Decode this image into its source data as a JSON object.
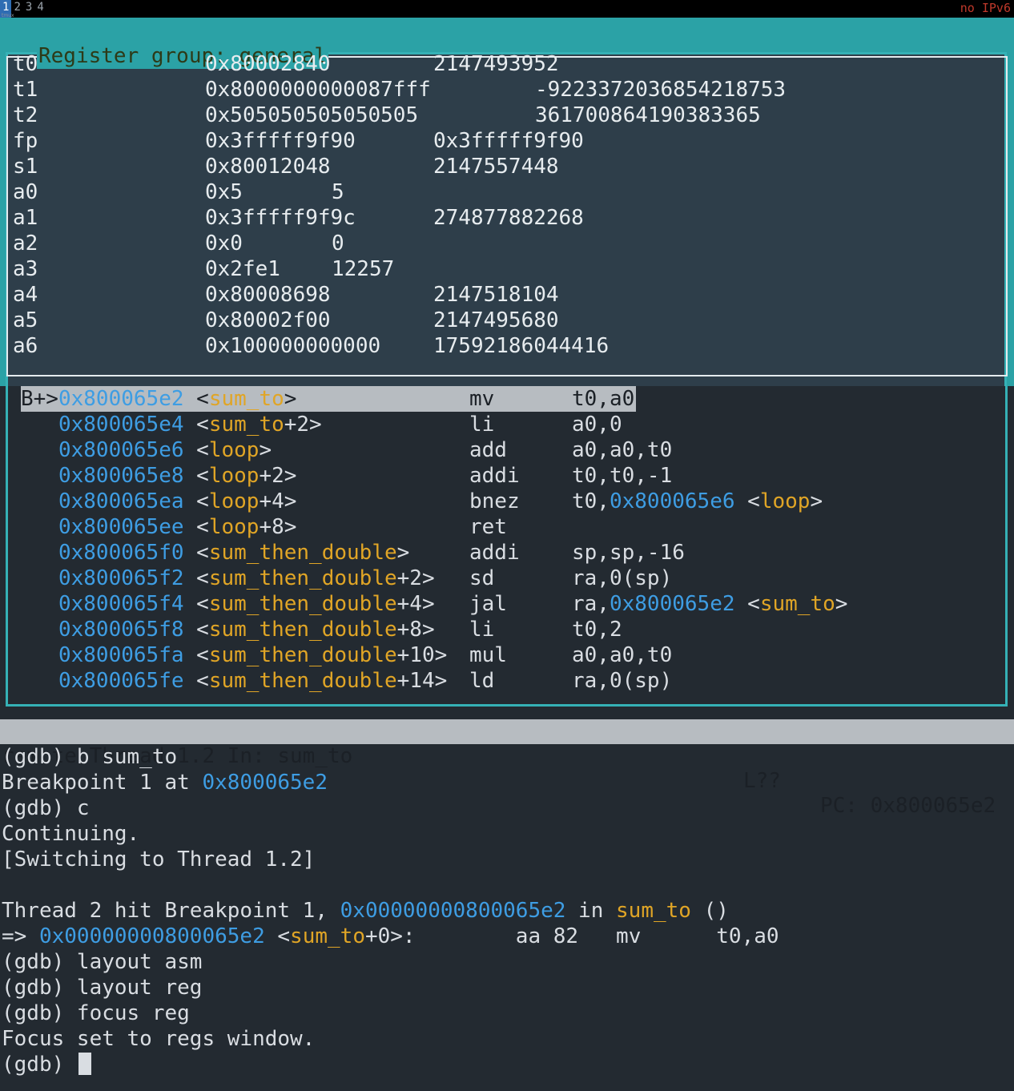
{
  "tmux": {
    "tabs": [
      "1",
      "2",
      "3",
      "4"
    ],
    "active_tab": "1",
    "session": "tmux",
    "right_status": "no IPv6"
  },
  "register_window": {
    "title_prefix": "Register group:",
    "title_group": "general",
    "rows": [
      {
        "name": "t0",
        "hex": "0x80002840",
        "dec": "2147493952"
      },
      {
        "name": "t1",
        "hex": "0x8000000000087fff",
        "dec": "-9223372036854218753"
      },
      {
        "name": "t2",
        "hex": "0x505050505050505",
        "dec": "361700864190383365"
      },
      {
        "name": "fp",
        "hex": "0x3fffff9f90",
        "dec": "0x3fffff9f90"
      },
      {
        "name": "s1",
        "hex": "0x80012048",
        "dec": "2147557448"
      },
      {
        "name": "a0",
        "hex": "0x5",
        "dec": "5"
      },
      {
        "name": "a1",
        "hex": "0x3fffff9f9c",
        "dec": "274877882268"
      },
      {
        "name": "a2",
        "hex": "0x0",
        "dec": "0"
      },
      {
        "name": "a3",
        "hex": "0x2fe1",
        "dec": "12257"
      },
      {
        "name": "a4",
        "hex": "0x80008698",
        "dec": "2147518104"
      },
      {
        "name": "a5",
        "hex": "0x80002f00",
        "dec": "2147495680"
      },
      {
        "name": "a6",
        "hex": "0x100000000000",
        "dec": "17592186044416"
      }
    ]
  },
  "asm_window": {
    "rows": [
      {
        "marker": "B+>",
        "addr": "0x800065e2",
        "sym": "sum_to",
        "off": "",
        "mnemonic": "mv",
        "operands": "t0,a0",
        "target_addr": "",
        "target_sym": "",
        "current": true
      },
      {
        "marker": "",
        "addr": "0x800065e4",
        "sym": "sum_to",
        "off": "+2",
        "mnemonic": "li",
        "operands": "a0,0",
        "target_addr": "",
        "target_sym": "",
        "current": false
      },
      {
        "marker": "",
        "addr": "0x800065e6",
        "sym": "loop",
        "off": "",
        "mnemonic": "add",
        "operands": "a0,a0,t0",
        "target_addr": "",
        "target_sym": "",
        "current": false
      },
      {
        "marker": "",
        "addr": "0x800065e8",
        "sym": "loop",
        "off": "+2",
        "mnemonic": "addi",
        "operands": "t0,t0,-1",
        "target_addr": "",
        "target_sym": "",
        "current": false
      },
      {
        "marker": "",
        "addr": "0x800065ea",
        "sym": "loop",
        "off": "+4",
        "mnemonic": "bnez",
        "operands": "t0,",
        "target_addr": "0x800065e6",
        "target_sym": "loop",
        "current": false
      },
      {
        "marker": "",
        "addr": "0x800065ee",
        "sym": "loop",
        "off": "+8",
        "mnemonic": "ret",
        "operands": "",
        "target_addr": "",
        "target_sym": "",
        "current": false
      },
      {
        "marker": "",
        "addr": "0x800065f0",
        "sym": "sum_then_double",
        "off": "",
        "mnemonic": "addi",
        "operands": "sp,sp,-16",
        "target_addr": "",
        "target_sym": "",
        "current": false
      },
      {
        "marker": "",
        "addr": "0x800065f2",
        "sym": "sum_then_double",
        "off": "+2",
        "mnemonic": "sd",
        "operands": "ra,0(sp)",
        "target_addr": "",
        "target_sym": "",
        "current": false
      },
      {
        "marker": "",
        "addr": "0x800065f4",
        "sym": "sum_then_double",
        "off": "+4",
        "mnemonic": "jal",
        "operands": "ra,",
        "target_addr": "0x800065e2",
        "target_sym": "sum_to",
        "current": false
      },
      {
        "marker": "",
        "addr": "0x800065f8",
        "sym": "sum_then_double",
        "off": "+8",
        "mnemonic": "li",
        "operands": "t0,2",
        "target_addr": "",
        "target_sym": "",
        "current": false
      },
      {
        "marker": "",
        "addr": "0x800065fa",
        "sym": "sum_then_double",
        "off": "+10",
        "mnemonic": "mul",
        "operands": "a0,a0,t0",
        "target_addr": "",
        "target_sym": "",
        "current": false
      },
      {
        "marker": "",
        "addr": "0x800065fe",
        "sym": "sum_then_double",
        "off": "+14",
        "mnemonic": "ld",
        "operands": "ra,0(sp)",
        "target_addr": "",
        "target_sym": "",
        "current": false
      }
    ]
  },
  "status": {
    "left": "remote Thread 1.2 In: sum_to",
    "line": "L??",
    "pc": "PC: 0x800065e2"
  },
  "console": {
    "lines": [
      [
        {
          "t": "(gdb) b sum_to",
          "c": "plain"
        }
      ],
      [
        {
          "t": "Breakpoint 1 at ",
          "c": "plain"
        },
        {
          "t": "0x800065e2",
          "c": "addr"
        }
      ],
      [
        {
          "t": "(gdb) c",
          "c": "plain"
        }
      ],
      [
        {
          "t": "Continuing.",
          "c": "plain"
        }
      ],
      [
        {
          "t": "[Switching to Thread 1.2]",
          "c": "plain"
        }
      ],
      [],
      [
        {
          "t": "Thread 2 hit Breakpoint 1, ",
          "c": "plain"
        },
        {
          "t": "0x00000000800065e2",
          "c": "addr"
        },
        {
          "t": " in ",
          "c": "plain"
        },
        {
          "t": "sum_to",
          "c": "sym"
        },
        {
          "t": " ()",
          "c": "plain"
        }
      ],
      [
        {
          "t": "=> ",
          "c": "plain"
        },
        {
          "t": "0x00000000800065e2",
          "c": "addr"
        },
        {
          "t": " <",
          "c": "plain"
        },
        {
          "t": "sum_to",
          "c": "sym"
        },
        {
          "t": "+0>:        aa 82   mv      t0,a0",
          "c": "plain"
        }
      ],
      [
        {
          "t": "(gdb) layout asm",
          "c": "plain"
        }
      ],
      [
        {
          "t": "(gdb) layout reg",
          "c": "plain"
        }
      ],
      [
        {
          "t": "(gdb) focus reg",
          "c": "plain"
        }
      ],
      [
        {
          "t": "Focus set to regs window.",
          "c": "plain"
        }
      ],
      [
        {
          "t": "(gdb) ",
          "c": "plain"
        }
      ]
    ]
  },
  "colors": {
    "background": "#232a31",
    "window_border": "#35b1b6",
    "address": "#3e9de3",
    "symbol": "#e0a526",
    "highlight_bar": "#b7bcc1",
    "tmux_alert": "#c0392b"
  }
}
